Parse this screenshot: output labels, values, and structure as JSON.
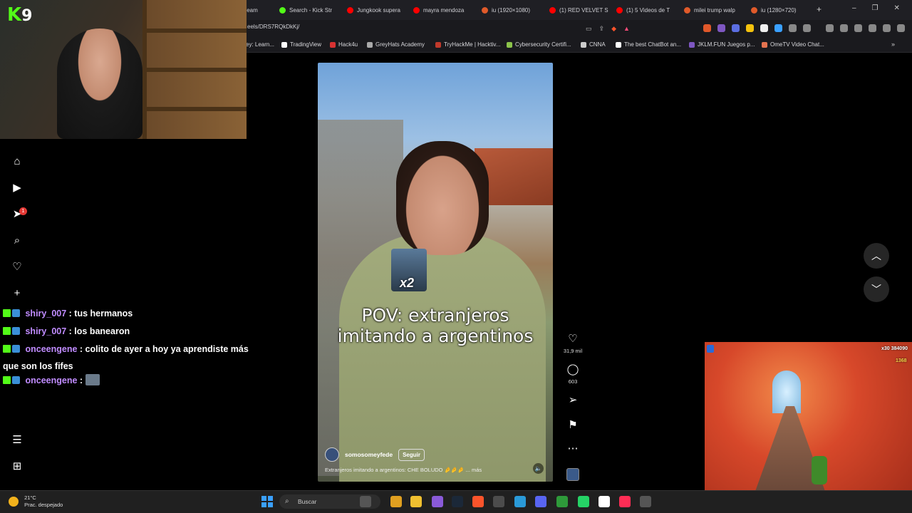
{
  "stream": {
    "logo_k": "K",
    "logo_num": "9"
  },
  "browser": {
    "tabs": [
      {
        "label": "Stream",
        "color": "#8a8a8a"
      },
      {
        "label": "Search - Kick Str",
        "color": "#53fc18"
      },
      {
        "label": "Jungkook supera",
        "color": "#ff0000"
      },
      {
        "label": "mayra mendoza",
        "color": "#ff0000"
      },
      {
        "label": "iu (1920×1080)",
        "color": "#e05a2a"
      },
      {
        "label": "(1) RED VELVET S",
        "color": "#ff0000"
      },
      {
        "label": "(1) 5 Videos de T",
        "color": "#ff0000"
      },
      {
        "label": "milei trump walp",
        "color": "#e05a2a"
      },
      {
        "label": "iu (1280×720)",
        "color": "#e05a2a"
      }
    ],
    "new_tab": "+",
    "url": "eels/DRS7RQkDkKj/",
    "bookmarks": [
      {
        "label": "ey: Learn...",
        "color": "#888"
      },
      {
        "label": "TradingView",
        "color": "#fff"
      },
      {
        "label": "Hack4u",
        "color": "#d83232"
      },
      {
        "label": "GreyHats Academy",
        "color": "#aaa"
      },
      {
        "label": "TryHackMe | Hacktiv...",
        "color": "#c0392b"
      },
      {
        "label": "Cybersecurity Certifi...",
        "color": "#8bc34a"
      },
      {
        "label": "CNNA",
        "color": "#ccc"
      },
      {
        "label": "The best ChatBot an...",
        "color": "#fff"
      },
      {
        "label": "JKLM.FUN Juegos p...",
        "color": "#7e57c2"
      },
      {
        "label": "OmeTV Video Chat...",
        "color": "#e57350"
      }
    ]
  },
  "sidebar": {
    "notif_count": "1"
  },
  "chat": [
    {
      "user": "shiry_007",
      "message": ": tus hermanos"
    },
    {
      "user": "shiry_007",
      "message": ": los banearon"
    },
    {
      "user": "onceengene",
      "message": ": colito de ayer a hoy ya aprendiste más que son los fifes"
    },
    {
      "user": "onceengene",
      "message": ":"
    }
  ],
  "reel": {
    "caption_line1": "POV: extranjeros",
    "caption_line2": "imitando a argentinos",
    "sticker": "x2",
    "author": "somosomeyfede",
    "follow": "Seguir",
    "description": "Extranjeros imitando a argentinos: CHE BOLUDO 🤌🤌🤌 ... más",
    "likes": "31,9 mil",
    "comments": "603"
  },
  "game": {
    "score_top": "x30  384090",
    "score_coins": "1368"
  },
  "taskbar": {
    "temp": "21°C",
    "weather": "Prac. despejado",
    "search_placeholder": "Buscar"
  }
}
